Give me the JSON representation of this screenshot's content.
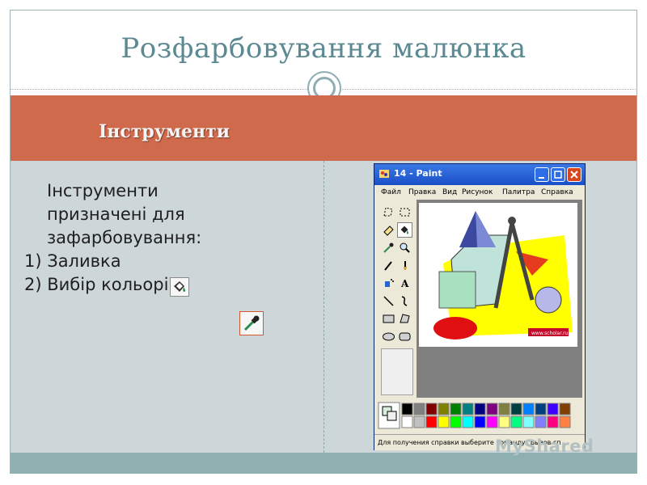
{
  "slide": {
    "title": "Розфарбовування малюнка",
    "header": "Інструменти",
    "body_lines": [
      "Інструменти",
      "призначені для",
      "зафарбовування:",
      "1) Заливка",
      "2) Вибір кольорів"
    ]
  },
  "paint": {
    "window_title": "14 - Paint",
    "menu": [
      "Файл",
      "Правка",
      "Вид",
      "Рисунок",
      "Палитра",
      "Справка"
    ],
    "status": "Для получения справки выберите команду \"Вызов сп",
    "canvas_caption": "www.scholar.ru"
  },
  "watermark": {
    "text": "MyShared"
  },
  "colors": {
    "accent": "#d06a4d",
    "title": "#5b8a92",
    "content_bg": "#cdd7d9",
    "footer": "#8fb0b1"
  },
  "palette": [
    "#000000",
    "#808080",
    "#800000",
    "#808000",
    "#008000",
    "#008080",
    "#000080",
    "#800080",
    "#808040",
    "#004040",
    "#0080ff",
    "#004080",
    "#4000ff",
    "#804000",
    "#ffffff",
    "#c0c0c0",
    "#ff0000",
    "#ffff00",
    "#00ff00",
    "#00ffff",
    "#0000ff",
    "#ff00ff",
    "#ffff80",
    "#00ff80",
    "#80ffff",
    "#8080ff",
    "#ff0080",
    "#ff8040"
  ]
}
